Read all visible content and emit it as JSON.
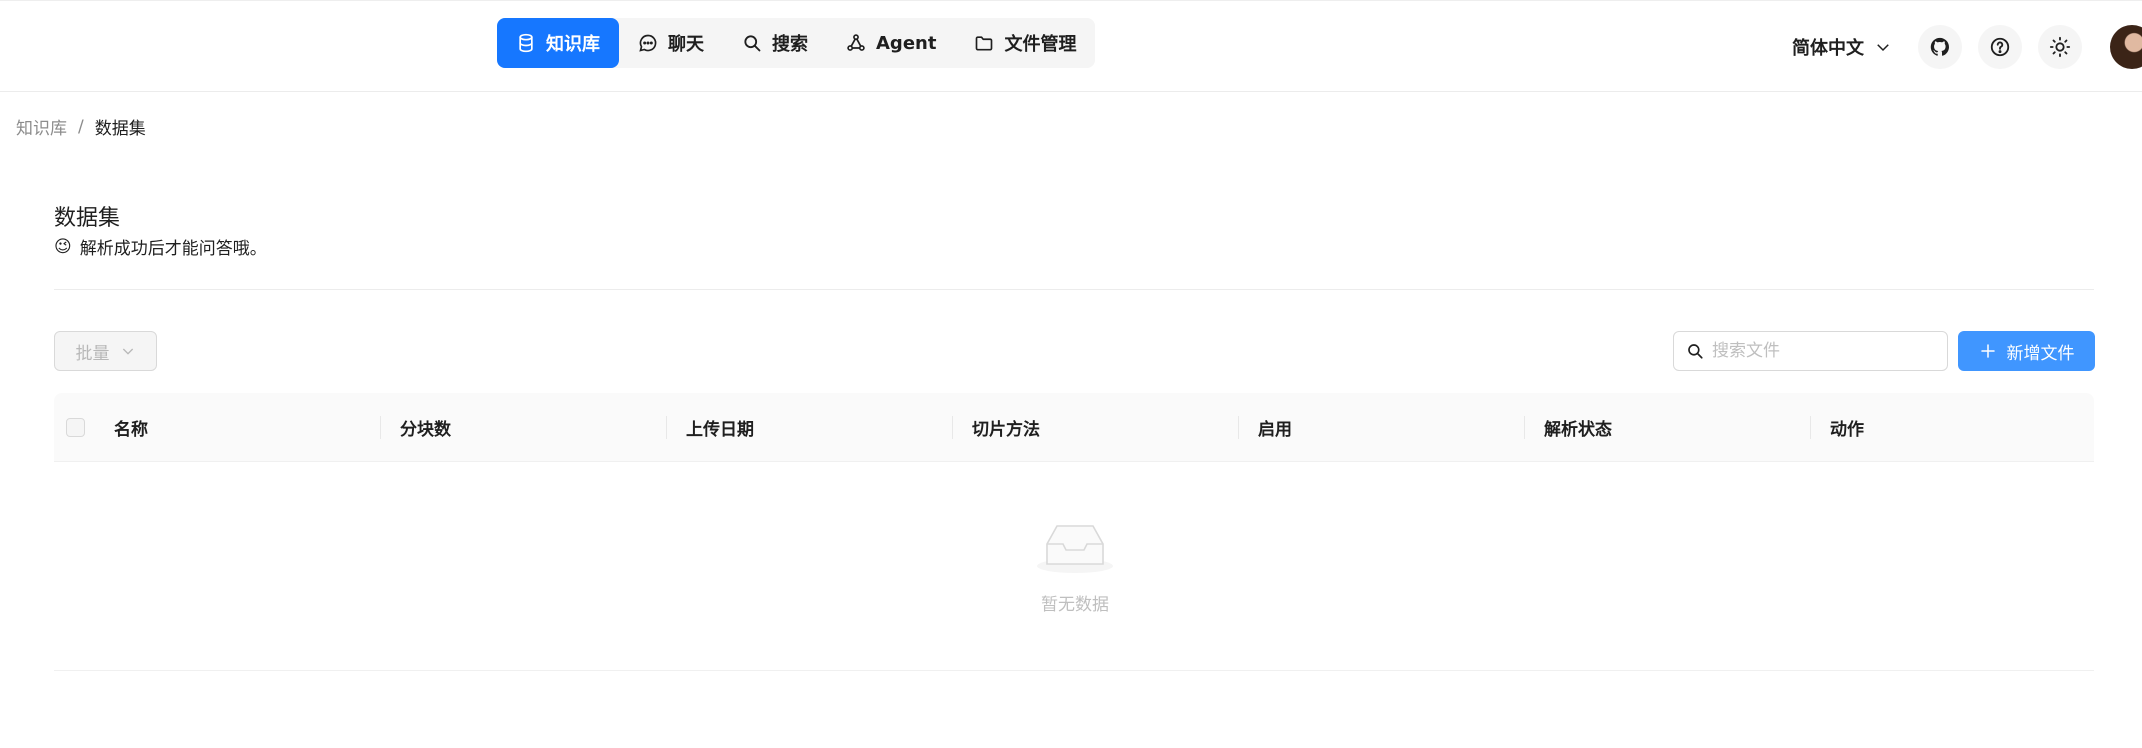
{
  "nav": {
    "items": [
      {
        "label": "知识库",
        "icon": "database-icon",
        "active": true
      },
      {
        "label": "聊天",
        "icon": "chat-bubble-icon",
        "active": false
      },
      {
        "label": "搜索",
        "icon": "search-icon",
        "active": false
      },
      {
        "label": "Agent",
        "icon": "agent-graph-icon",
        "active": false
      },
      {
        "label": "文件管理",
        "icon": "folder-icon",
        "active": false
      }
    ]
  },
  "header": {
    "language": "简体中文",
    "icons": [
      "github-icon",
      "help-icon",
      "sun-icon"
    ]
  },
  "breadcrumb": {
    "root": "知识库",
    "separator": "/",
    "current": "数据集"
  },
  "page": {
    "title": "数据集",
    "description_emoji": "😉",
    "description": "解析成功后才能问答哦。"
  },
  "toolbar": {
    "batch_label": "批量",
    "search_placeholder": "搜索文件",
    "add_label": "新增文件"
  },
  "table": {
    "columns": [
      "名称",
      "分块数",
      "上传日期",
      "切片方法",
      "启用",
      "解析状态",
      "动作"
    ],
    "rows": [],
    "empty_text": "暂无数据"
  },
  "colors": {
    "accent": "#1677ff",
    "add_button": "#4096ff"
  }
}
